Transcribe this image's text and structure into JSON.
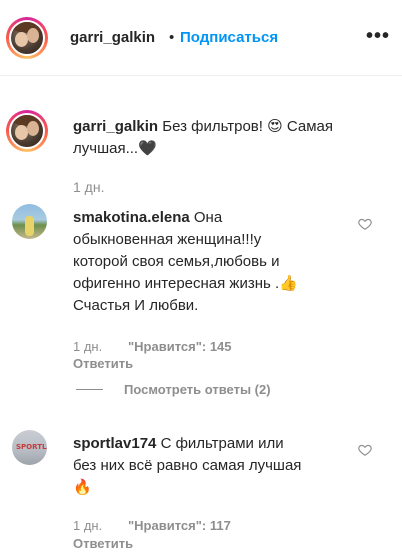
{
  "header": {
    "username": "garri_galkin",
    "separator": "•",
    "follow_label": "Подписаться",
    "more_label": "•••"
  },
  "caption": {
    "username": "garri_galkin",
    "line1": "Без фильтров! 😍 Самая",
    "line2": "лучшая...🖤",
    "time": "1 дн."
  },
  "comments": [
    {
      "username": "smakotina.elena",
      "line1": "Она",
      "line2": "обыкновенная женщина!!!у",
      "line3": "которой своя семья,любовь и",
      "line4": "офигенно интересная жизнь .👍",
      "line5": "Счастья И любви.",
      "time": "1 дн.",
      "likes_label": "\"Нравится\": 145",
      "reply_label": "Ответить",
      "view_replies_label": "Посмотреть ответы (2)"
    },
    {
      "username": "sportlav174",
      "line1": "С фильтрами или",
      "line2": "без них всё равно самая лучшая",
      "line3": "🔥",
      "time": "1 дн.",
      "likes_label": "\"Нравится\": 117",
      "reply_label": "Ответить",
      "avatar_text": "SPORTLAV"
    }
  ],
  "colors": {
    "accent": "#0095f6",
    "text": "#262626",
    "muted": "#8e8e8e"
  },
  "icons": [
    "heart-outline-icon",
    "more-icon"
  ]
}
